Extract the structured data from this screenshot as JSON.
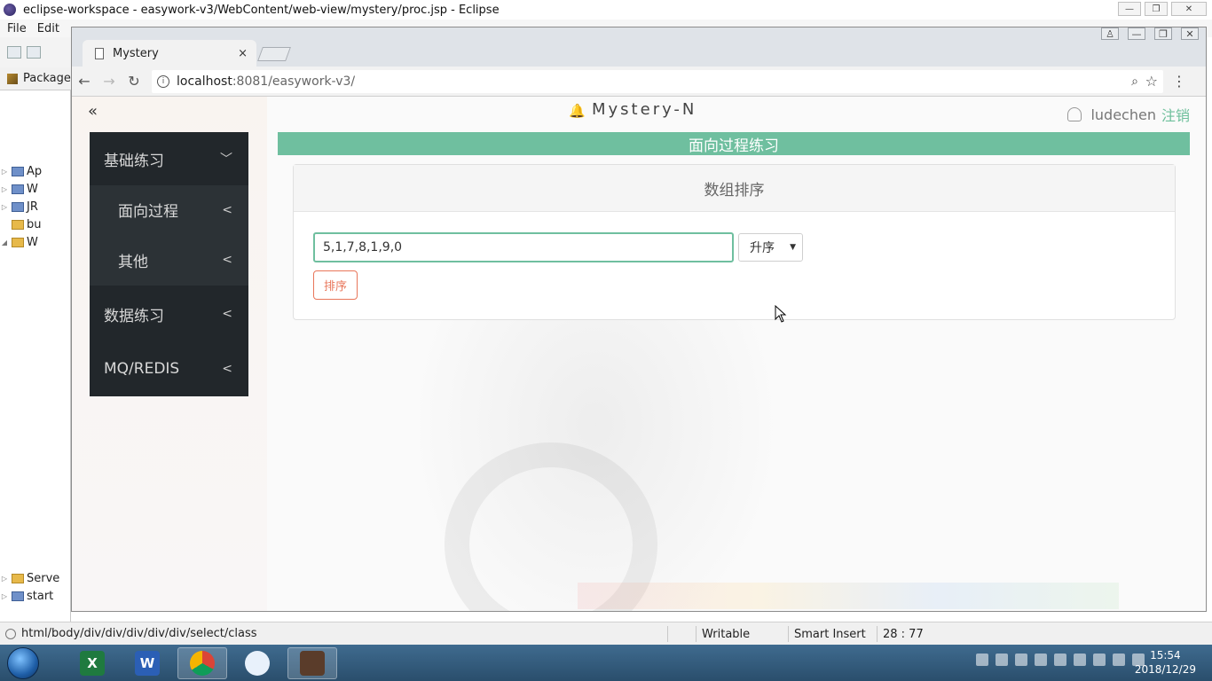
{
  "eclipse": {
    "window_title": "eclipse-workspace - easywork-v3/WebContent/web-view/mystery/proc.jsp - Eclipse",
    "menu": [
      "File",
      "Edit"
    ],
    "package_tab_label": "Package",
    "tree_items": [
      {
        "label": "Ap"
      },
      {
        "label": "W"
      },
      {
        "label": "JR"
      },
      {
        "label": "bu"
      },
      {
        "label": "W"
      }
    ],
    "bottom_tree": [
      "Serve",
      "start"
    ],
    "status": {
      "path": "html/body/div/div/div/div/div/select/class",
      "mode": "Writable",
      "insert": "Smart Insert",
      "position": "28 : 77"
    }
  },
  "browser": {
    "tab_title": "Mystery",
    "tab_close": "×",
    "url_host": "localhost",
    "url_rest": ":8081/easywork-v3/"
  },
  "page": {
    "collapse_glyph": "«",
    "brand": "Mystery-N",
    "user": "ludechen",
    "logout": "注销",
    "sidebar": [
      {
        "label": "基础练习",
        "chev": "﹀",
        "sub": false
      },
      {
        "label": "面向过程",
        "chev": "<",
        "sub": true
      },
      {
        "label": "其他",
        "chev": "<",
        "sub": true
      },
      {
        "label": "数据练习",
        "chev": "<",
        "sub": false
      },
      {
        "label": "MQ/REDIS",
        "chev": "<",
        "sub": false
      }
    ],
    "section_title": "面向过程练习",
    "card_title": "数组排序",
    "input_value": "5,1,7,8,1,9,0",
    "select_value": "升序",
    "sort_button": "排序"
  },
  "taskbar": {
    "time": "15:54",
    "date": "2018/12/29"
  },
  "colors": {
    "accent_green": "#6fbf9f",
    "button_orange": "#e8765a",
    "sidebar_bg": "#22272b"
  }
}
